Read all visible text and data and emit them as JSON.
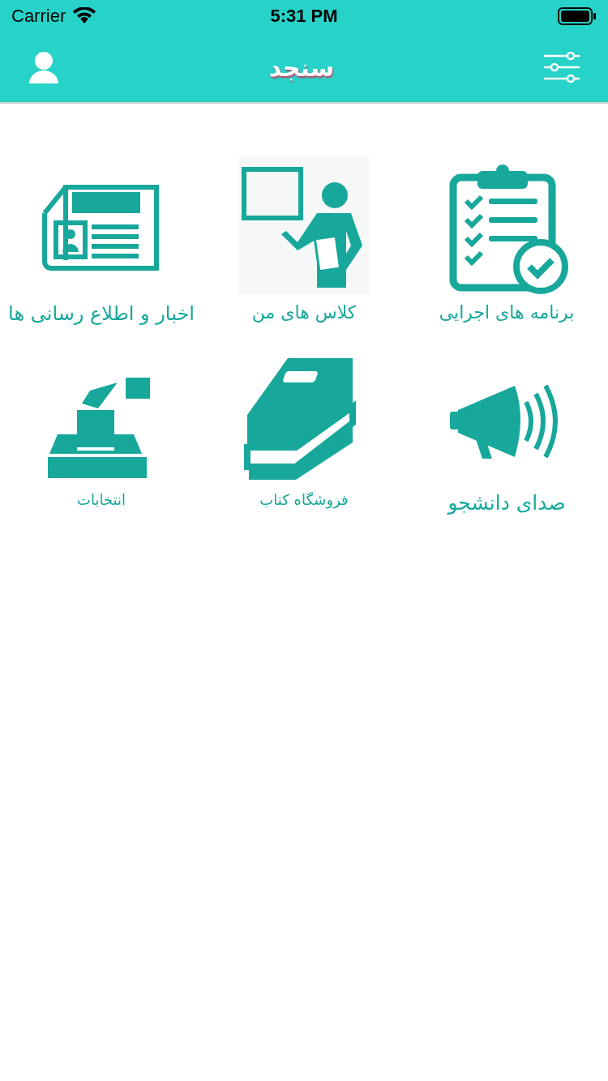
{
  "status_bar": {
    "carrier": "Carrier",
    "time": "5:31 PM"
  },
  "header": {
    "title": "سنجد"
  },
  "menu_items": [
    {
      "label": "برنامه های اجرایی"
    },
    {
      "label": "کلاس های من"
    },
    {
      "label": "اخبار و اطلاع رسانی ها"
    },
    {
      "label": "صدای دانشجو"
    },
    {
      "label": "فروشگاه کتاب"
    },
    {
      "label": "انتخابات"
    }
  ]
}
